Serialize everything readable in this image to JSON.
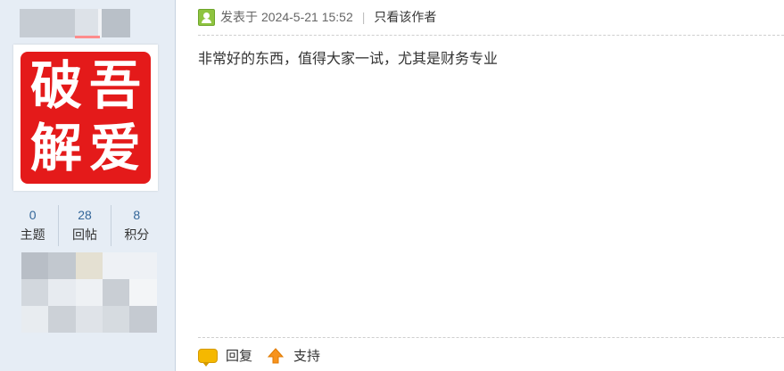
{
  "sidebar": {
    "avatar_chars": [
      "破",
      "吾",
      "解",
      "爱"
    ],
    "stats": [
      {
        "value": "0",
        "label": "主题"
      },
      {
        "value": "28",
        "label": "回帖"
      },
      {
        "value": "8",
        "label": "积分"
      }
    ]
  },
  "post": {
    "posted_prefix": "发表于",
    "date": "2024-5-21 15:52",
    "separator": "|",
    "author_only": "只看该作者",
    "content": "非常好的东西，值得大家一试，尤其是财务专业"
  },
  "actions": {
    "reply_label": "回复",
    "support_label": "支持"
  },
  "colors": {
    "sidebar_bg": "#e6edf5",
    "seal_red": "#e41a1a",
    "link_blue": "#336699"
  }
}
